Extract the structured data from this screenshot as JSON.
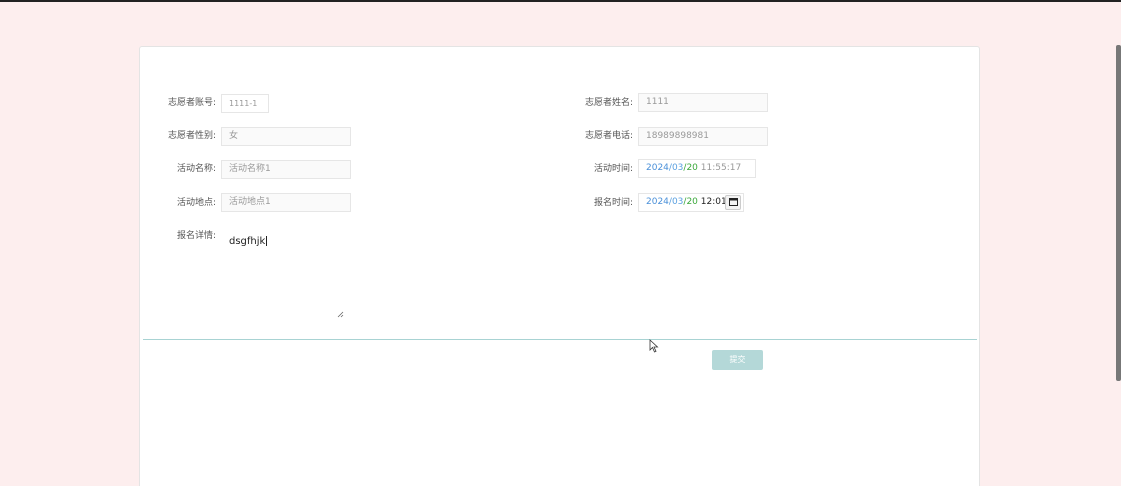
{
  "form": {
    "account_label": "志愿者账号:",
    "account_value": "1111-1",
    "name_label": "志愿者姓名:",
    "name_value": "1111",
    "gender_label": "志愿者性别:",
    "gender_value": "女",
    "phone_label": "志愿者电话:",
    "phone_value": "18989898981",
    "activity_name_label": "活动名称:",
    "activity_name_placeholder": "活动名称1",
    "activity_time_label": "活动时间:",
    "activity_time": {
      "year": "2024",
      "month": "03",
      "day": "20",
      "time": "11:55:17"
    },
    "activity_place_label": "活动地点:",
    "activity_place_placeholder": "活动地点1",
    "signup_time_label": "报名时间:",
    "signup_time": {
      "year": "2024",
      "month": "03",
      "day": "20",
      "time": "12:01"
    },
    "details_label": "报名详情:",
    "details_value": "dsgfhjk",
    "submit_label": "提交"
  },
  "icons": {
    "calendar": "calendar-icon",
    "resize": "resize-grip-icon",
    "cursor": "mouse-pointer-icon"
  }
}
